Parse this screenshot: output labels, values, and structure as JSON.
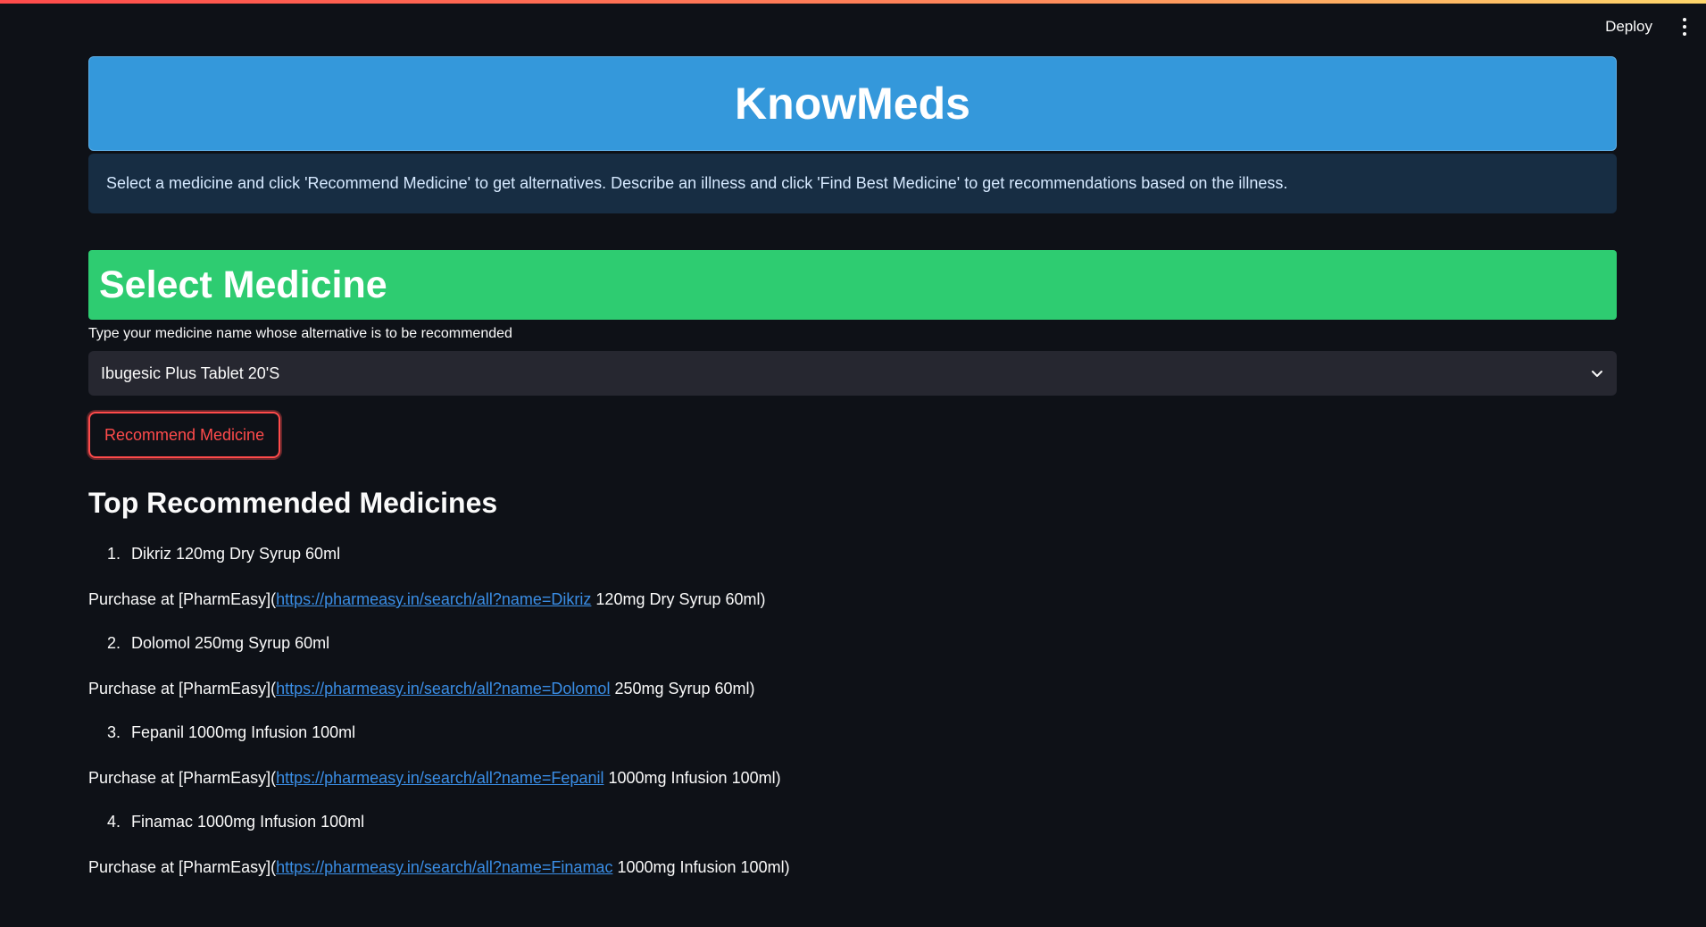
{
  "header": {
    "deploy_label": "Deploy",
    "menu_icon": "kebab-menu-icon"
  },
  "hero": {
    "title": "KnowMeds",
    "bg_color": "#3498db"
  },
  "info": {
    "text": "Select a medicine and click 'Recommend Medicine' to get alternatives. Describe an illness and click 'Find Best Medicine' to get recommendations based on the illness."
  },
  "select_section": {
    "title": "Select Medicine",
    "bg_color": "#2ecc71",
    "field_label": "Type your medicine name whose alternative is to be recommended",
    "selected_value": "Ibugesic Plus Tablet 20'S",
    "chevron_icon": "chevron-down-icon",
    "button_label": "Recommend Medicine",
    "button_color": "#ff4b4b"
  },
  "results": {
    "title": "Top Recommended Medicines",
    "items": [
      {
        "number": "1.",
        "name": "Dikriz 120mg Dry Syrup 60ml",
        "purchase_prefix": "Purchase at [PharmEasy](",
        "link_text": "https://pharmeasy.in/search/all?name=Dikriz",
        "purchase_suffix": " 120mg Dry Syrup 60ml)"
      },
      {
        "number": "2.",
        "name": "Dolomol 250mg Syrup 60ml",
        "purchase_prefix": "Purchase at [PharmEasy](",
        "link_text": "https://pharmeasy.in/search/all?name=Dolomol",
        "purchase_suffix": " 250mg Syrup 60ml)"
      },
      {
        "number": "3.",
        "name": "Fepanil 1000mg Infusion 100ml",
        "purchase_prefix": "Purchase at [PharmEasy](",
        "link_text": "https://pharmeasy.in/search/all?name=Fepanil",
        "purchase_suffix": " 1000mg Infusion 100ml)"
      },
      {
        "number": "4.",
        "name": "Finamac 1000mg Infusion 100ml",
        "purchase_prefix": "Purchase at [PharmEasy](",
        "link_text": "https://pharmeasy.in/search/all?name=Finamac",
        "purchase_suffix": " 1000mg Infusion 100ml)"
      }
    ]
  }
}
